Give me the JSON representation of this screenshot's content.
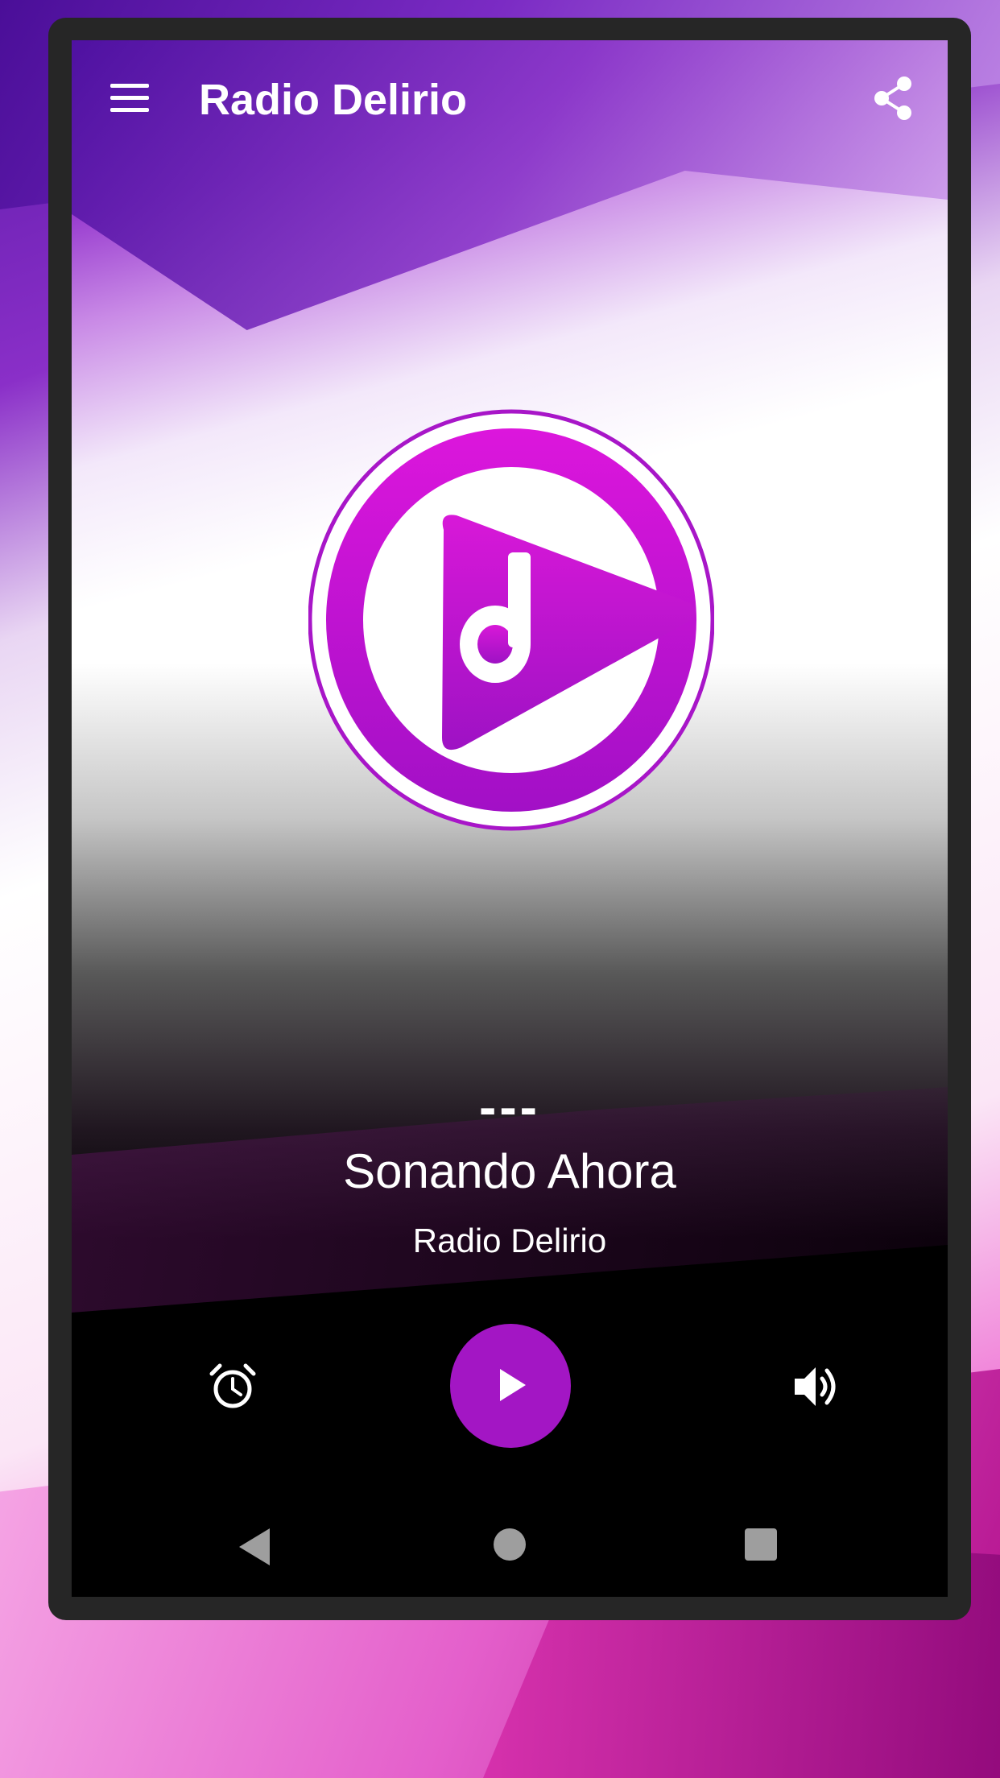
{
  "app": {
    "title": "Radio Delirio"
  },
  "now_playing": {
    "track": "---",
    "label": "Sonando Ahora",
    "station": "Radio Delirio"
  },
  "icons": {
    "menu": "hamburger-menu-icon",
    "share": "share-icon",
    "logo": "music-note-play-logo",
    "alarm": "alarm-clock-icon",
    "play": "play-icon",
    "volume": "volume-icon",
    "nav_back": "back-triangle-icon",
    "nav_home": "home-circle-icon",
    "nav_recent": "recent-square-icon"
  },
  "colors": {
    "accent": "#a316c4",
    "logo_outer": "#d51ad8",
    "logo_inner": "#a514c9",
    "nav_icon": "#9e9e9e"
  }
}
